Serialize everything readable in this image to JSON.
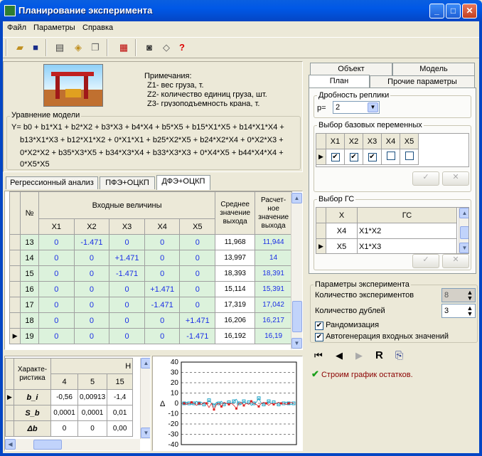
{
  "window": {
    "title": "Планирование эксперимента"
  },
  "menu": [
    "Файл",
    "Параметры",
    "Справка"
  ],
  "notes": {
    "title": "Примечания:",
    "lines": [
      "Z1- вес груза, т.",
      "Z2- количество единиц груза, шт.",
      "Z3- грузоподъемность крана, т."
    ]
  },
  "equation": {
    "label": "Уравнение модели",
    "lines": [
      "Y= b0 + b1*X1 + b2*X2 + b3*X3 + b4*X4 + b5*X5 + b15*X1*X5 + b14*X1*X4 +",
      "b13*X1*X3 + b12*X1*X2 + 0*X1*X1 + b25*X2*X5 + b24*X2*X4 + 0*X2*X3 +",
      "0*X2*X2 + b35*X3*X5 + b34*X3*X4 + b33*X3*X3 + 0*X4*X5 + b44*X4*X4 +",
      "0*X5*X5"
    ]
  },
  "left_tabs": [
    "Регрессионный анализ",
    "ПФЭ+ОЦКП",
    "ДФЭ+ОЦКП"
  ],
  "main_table": {
    "col_no": "№",
    "group_header": "Входные величины",
    "inputs": [
      "X1",
      "X2",
      "X3",
      "X4",
      "X5"
    ],
    "col_mean": "Среднее значение выхода",
    "col_calc": "Расчет-ное значение выхода",
    "rows": [
      {
        "n": "13",
        "x": [
          "0",
          "-1.471",
          "0",
          "0",
          "0"
        ],
        "mean": "11,968",
        "calc": "11,944"
      },
      {
        "n": "14",
        "x": [
          "0",
          "0",
          "+1.471",
          "0",
          "0"
        ],
        "mean": "13,997",
        "calc": "14"
      },
      {
        "n": "15",
        "x": [
          "0",
          "0",
          "-1.471",
          "0",
          "0"
        ],
        "mean": "18,393",
        "calc": "18,391"
      },
      {
        "n": "16",
        "x": [
          "0",
          "0",
          "0",
          "+1.471",
          "0"
        ],
        "mean": "15,114",
        "calc": "15,391"
      },
      {
        "n": "17",
        "x": [
          "0",
          "0",
          "0",
          "-1.471",
          "0"
        ],
        "mean": "17,319",
        "calc": "17,042"
      },
      {
        "n": "18",
        "x": [
          "0",
          "0",
          "0",
          "0",
          "+1.471"
        ],
        "mean": "16,206",
        "calc": "16,217"
      },
      {
        "n": "19",
        "x": [
          "0",
          "0",
          "0",
          "0",
          "-1.471"
        ],
        "mean": "16,192",
        "calc": "16,19"
      }
    ]
  },
  "coef_table": {
    "header": "Характе-ристика",
    "top_header": "Н",
    "cols": [
      "4",
      "5",
      "15"
    ],
    "rows": [
      {
        "name": "b_i",
        "vals": [
          "-0,56",
          "0,00913",
          "-1,4"
        ]
      },
      {
        "name": "S_b",
        "vals": [
          "0,0001",
          "0,0001",
          "0,01"
        ]
      },
      {
        "name": "Δb",
        "vals": [
          "0",
          "0",
          "0,00"
        ]
      }
    ]
  },
  "chart_data": {
    "type": "scatter",
    "ylabel": "Δ",
    "yticks": [
      "40",
      "30",
      "20",
      "10",
      "0",
      "-10",
      "-20",
      "-30",
      "-40"
    ],
    "ylim": [
      -40,
      40
    ],
    "grid": true,
    "series": [
      {
        "values": [
          0,
          1,
          0,
          -1,
          0,
          2,
          0,
          1,
          -1,
          0,
          3,
          0,
          -2,
          1,
          0,
          2,
          -1,
          0,
          1,
          0,
          2,
          4,
          0,
          -1,
          2,
          0,
          1,
          -2,
          0,
          1,
          5,
          0,
          -1,
          0,
          2,
          0,
          1,
          0,
          -1,
          0,
          0,
          1,
          0,
          -1,
          0
        ]
      },
      {
        "values": [
          0,
          -1,
          0,
          1,
          0,
          -2,
          0,
          -1,
          1,
          0,
          -4,
          0,
          -6,
          -1,
          0,
          -3,
          1,
          0,
          -1,
          0,
          -2,
          -5,
          0,
          1,
          -2,
          0,
          -1,
          2,
          0,
          -1,
          -3,
          0,
          1,
          0,
          -2,
          0,
          -1,
          0,
          1,
          0,
          0,
          -1,
          0,
          1,
          0
        ]
      }
    ],
    "colors": [
      "#1A9FC4",
      "#E02020"
    ]
  },
  "right_tabs": {
    "row1": [
      "Объект",
      "Модель"
    ],
    "row2": [
      "План",
      "Прочие параметры"
    ]
  },
  "replica": {
    "title": "Дробность реплики",
    "label": "p=",
    "value": "2"
  },
  "base_vars": {
    "title": "Выбор базовых переменных",
    "cols": [
      "X1",
      "X2",
      "X3",
      "X4",
      "X5"
    ],
    "checked": [
      true,
      true,
      true,
      false,
      false
    ]
  },
  "gs": {
    "title": "Выбор ГС",
    "col_x": "X",
    "col_gs": "ГС",
    "rows": [
      {
        "x": "X4",
        "gs": "X1*X2"
      },
      {
        "x": "X5",
        "gs": "X1*X3"
      }
    ]
  },
  "params": {
    "title": "Параметры эксперимента",
    "exp_count_label": "Количество экспериментов",
    "exp_count": "8",
    "dup_label": "Количество дублей",
    "dup_count": "3",
    "random_label": "Рандомизация",
    "autogen_label": "Автогенерация входных значений"
  },
  "status": {
    "text": "Строим график остатков."
  },
  "nav": {
    "r_label": "R"
  }
}
